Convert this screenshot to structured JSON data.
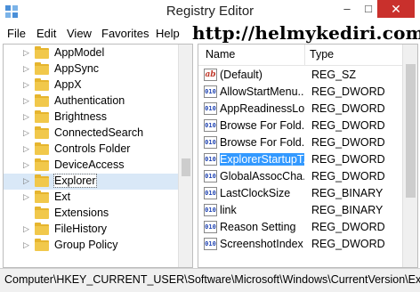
{
  "window": {
    "title": "Registry Editor"
  },
  "watermark": "http://helmykediri.com/",
  "menu": [
    "File",
    "Edit",
    "View",
    "Favorites",
    "Help"
  ],
  "tree": {
    "items": [
      {
        "label": "AppModel"
      },
      {
        "label": "AppSync"
      },
      {
        "label": "AppX"
      },
      {
        "label": "Authentication"
      },
      {
        "label": "Brightness"
      },
      {
        "label": "ConnectedSearch"
      },
      {
        "label": "Controls Folder"
      },
      {
        "label": "DeviceAccess"
      },
      {
        "label": "Explorer",
        "selected": true
      },
      {
        "label": "Ext"
      },
      {
        "label": "Extensions"
      },
      {
        "label": "FileHistory"
      },
      {
        "label": "Group Policy"
      }
    ]
  },
  "values": {
    "headers": {
      "name": "Name",
      "type": "Type"
    },
    "rows": [
      {
        "name": "(Default)",
        "type": "REG_SZ",
        "icon": "string-value-icon"
      },
      {
        "name": "AllowStartMenu...",
        "type": "REG_DWORD",
        "icon": "binary-value-icon"
      },
      {
        "name": "AppReadinessLo...",
        "type": "REG_DWORD",
        "icon": "binary-value-icon"
      },
      {
        "name": "Browse For Fold...",
        "type": "REG_DWORD",
        "icon": "binary-value-icon"
      },
      {
        "name": "Browse For Fold...",
        "type": "REG_DWORD",
        "icon": "binary-value-icon"
      },
      {
        "name": "ExplorerStartupT...",
        "type": "REG_DWORD",
        "icon": "binary-value-icon",
        "selected": true
      },
      {
        "name": "GlobalAssocCha...",
        "type": "REG_DWORD",
        "icon": "binary-value-icon"
      },
      {
        "name": "LastClockSize",
        "type": "REG_BINARY",
        "icon": "binary-value-icon"
      },
      {
        "name": "link",
        "type": "REG_BINARY",
        "icon": "binary-value-icon"
      },
      {
        "name": "Reason Setting",
        "type": "REG_DWORD",
        "icon": "binary-value-icon"
      },
      {
        "name": "ScreenshotIndex",
        "type": "REG_DWORD",
        "icon": "binary-value-icon"
      }
    ]
  },
  "status": {
    "path": "Computer\\HKEY_CURRENT_USER\\Software\\Microsoft\\Windows\\CurrentVersion\\Exp"
  },
  "colors": {
    "selection": "#3399ff",
    "close_button": "#c9302c",
    "folder": "#f1c84b"
  }
}
